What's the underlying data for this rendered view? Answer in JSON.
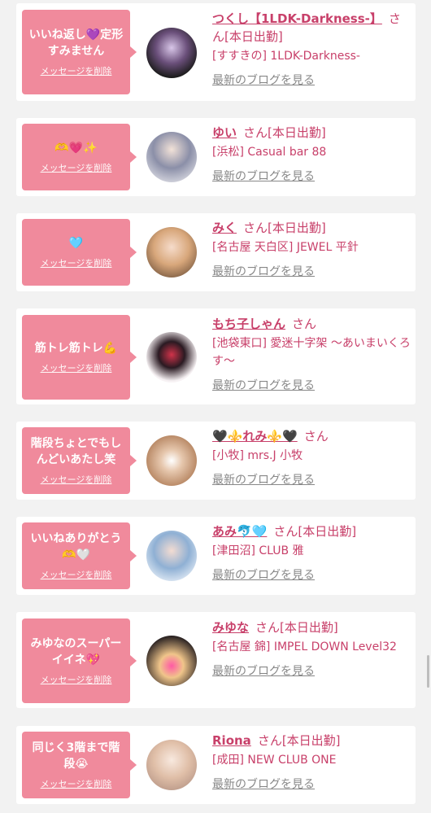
{
  "cards": [
    {
      "message": "いいね返し💜定形すみません",
      "delete_label": "メッセージを削除",
      "name": "つくし【1LDK-Darkness-】",
      "san": "さん",
      "status": "[本日出勤]",
      "shop": "[すすきの] 1LDK-Darkness-",
      "blog": "最新のブログを見る",
      "avatar_color": "#2b2b2b"
    },
    {
      "message": "🫶💗✨",
      "delete_label": "メッセージを削除",
      "name": "ゆい",
      "san": "さん",
      "status": "[本日出勤]",
      "shop": "[浜松] Casual bar 88",
      "blog": "最新のブログを見る",
      "avatar_color": "#cfcfd8"
    },
    {
      "message": "🩵",
      "delete_label": "メッセージを削除",
      "name": "みく",
      "san": "さん",
      "status": "[本日出勤]",
      "shop": "[名古屋 天白区] JEWEL 平針",
      "blog": "最新のブログを見る",
      "avatar_color": "#d9b28f"
    },
    {
      "message": "筋トレ筋トレ💪",
      "delete_label": "メッセージを削除",
      "name": "もち子しゃん",
      "san": "さん",
      "status": "",
      "shop": "[池袋東口] 愛迷十字架 〜あいまいくろす〜",
      "blog": "最新のブログを見る",
      "avatar_color": "#f4eef0"
    },
    {
      "message": "階段ちょとでもしんどいあたし笑",
      "delete_label": "メッセージを削除",
      "name": "🖤⚜️れみ⚜️🖤",
      "san": "さん",
      "status": "",
      "shop": "[小牧] mrs.J 小牧",
      "blog": "最新のブログを見る",
      "avatar_color": "#c89a78"
    },
    {
      "message": "いいねありがとう🫶🤍",
      "delete_label": "メッセージを削除",
      "name": "あみ🐬🩵",
      "san": "さん",
      "status": "[本日出勤]",
      "shop": "[津田沼] CLUB 雅",
      "blog": "最新のブログを見る",
      "avatar_color": "#9fb8d4"
    },
    {
      "message": "みゆなのスーパーイイネ💖",
      "delete_label": "メッセージを削除",
      "name": "みゆな",
      "san": "さん",
      "status": "[本日出勤]",
      "shop": "[名古屋 錦] IMPEL DOWN Level32",
      "blog": "最新のブログを見る",
      "avatar_color": "#3a3030"
    },
    {
      "message": "同じく3階まで階段😭",
      "delete_label": "メッセージを削除",
      "name": "Riona",
      "san": "さん",
      "status": "[本日出勤]",
      "shop": "[成田] NEW CLUB ONE",
      "blog": "最新のブログを見る",
      "avatar_color": "#e7d2c6"
    }
  ]
}
